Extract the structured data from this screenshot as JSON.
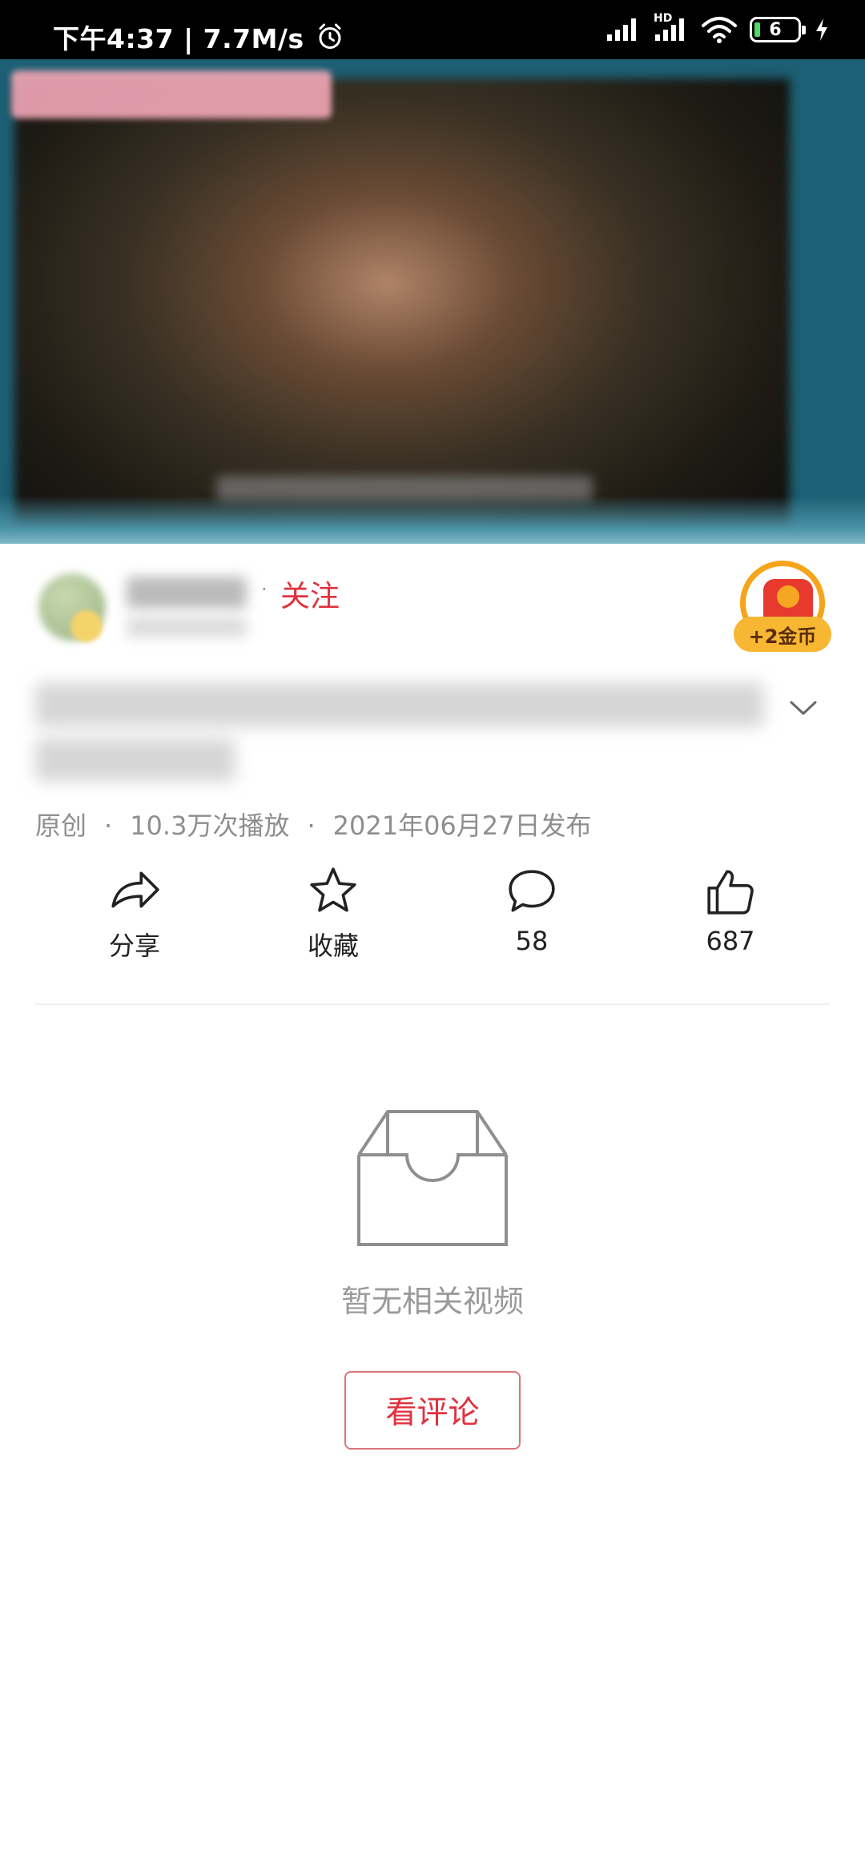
{
  "status_bar": {
    "time_and_speed": "下午4:37 | 7.7M/s",
    "hd_label": "HD",
    "battery_level": "6"
  },
  "author": {
    "separator": "·",
    "follow_label": "关注"
  },
  "coin_widget": {
    "label": "+2金币"
  },
  "meta": {
    "original": "原创",
    "separator": "·",
    "plays": "10.3万次播放",
    "published": "2021年06月27日发布"
  },
  "actions": {
    "share_label": "分享",
    "favorite_label": "收藏",
    "comment_count": "58",
    "like_count": "687"
  },
  "empty_state": {
    "message": "暂无相关视频",
    "view_comments_label": "看评论"
  },
  "colors": {
    "accent_red": "#e0323e",
    "muted_text": "#8e8e8e",
    "coin_orange": "#f7b733"
  }
}
